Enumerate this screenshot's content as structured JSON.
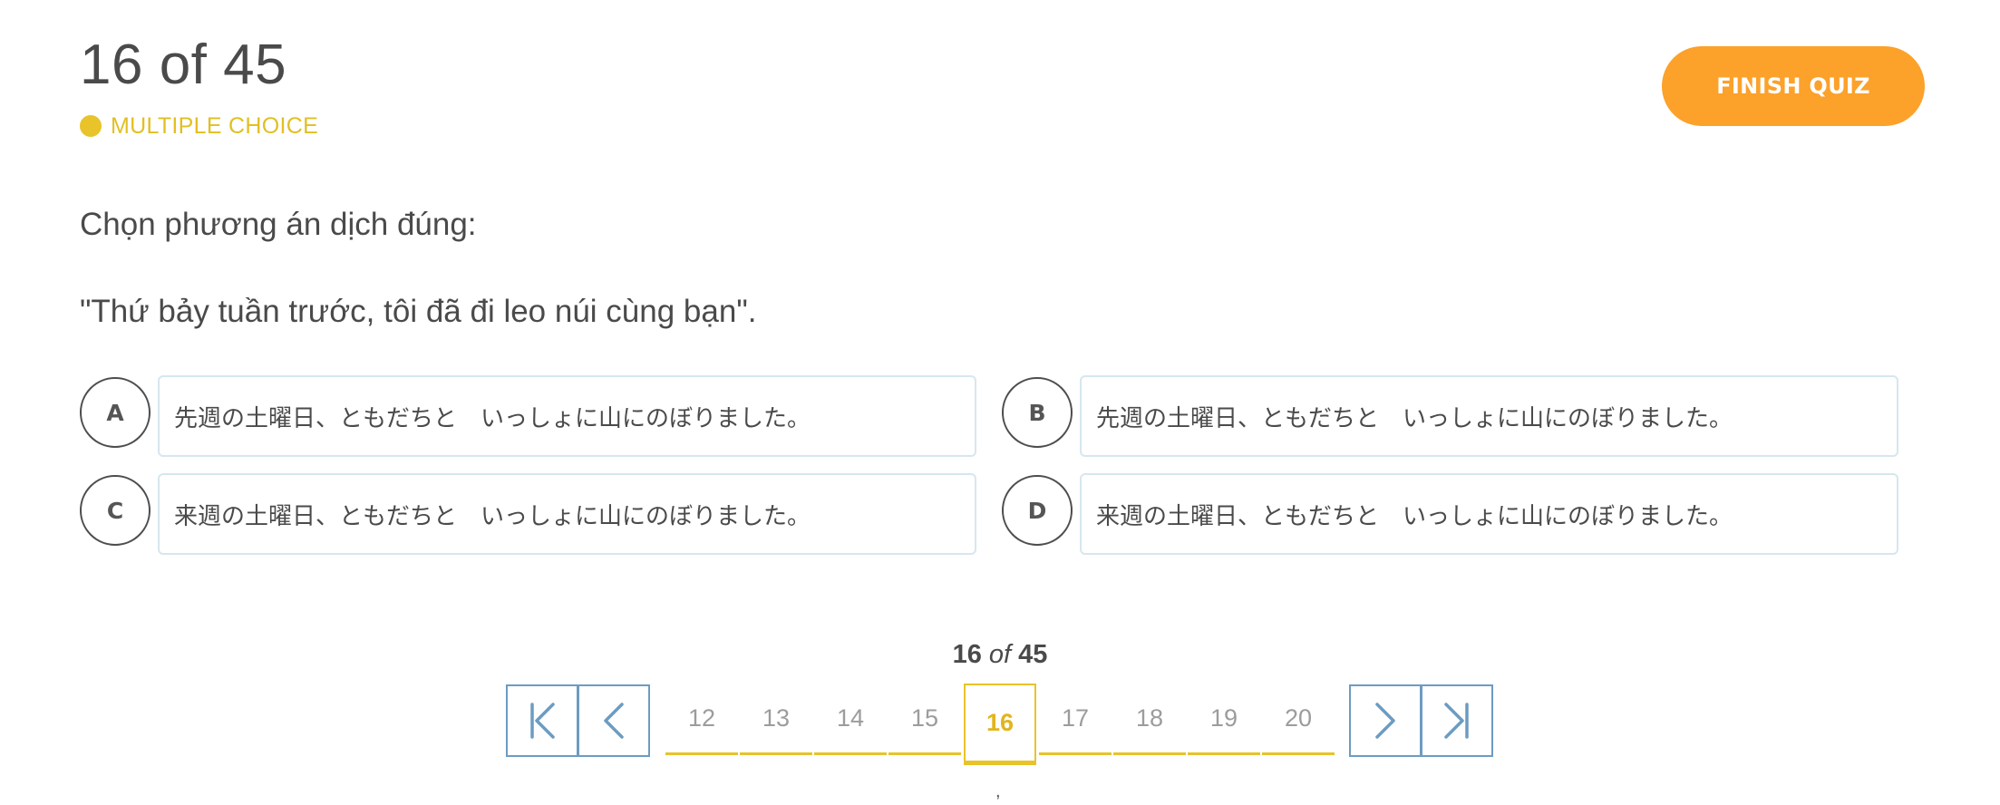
{
  "header": {
    "counter": "16 of 45",
    "question_type": "MULTIPLE CHOICE",
    "finish_label": "FINISH QUIZ"
  },
  "question": {
    "prompt": "Chọn phương án dịch đúng:",
    "sentence": "\"Thứ bảy tuần trước, tôi đã đi leo núi cùng bạn\"."
  },
  "options": [
    {
      "letter": "A",
      "text": "先週の土曜日、ともだちと　いっしょに山にのぼりました。"
    },
    {
      "letter": "B",
      "text": "先週の土曜日、ともだちと　いっしょに山にのぼりました。"
    },
    {
      "letter": "C",
      "text": "来週の土曜日、ともだちと　いっしょに山にのぼりました。"
    },
    {
      "letter": "D",
      "text": "来週の土曜日、ともだちと　いっしょに山にのぼりました。"
    }
  ],
  "pagination": {
    "current": "16",
    "of": "of",
    "total": "45",
    "pages": [
      "12",
      "13",
      "14",
      "15",
      "16",
      "17",
      "18",
      "19",
      "20"
    ],
    "tick": ","
  },
  "icons": {
    "first": "first-page-icon",
    "prev": "chevron-left-icon",
    "next": "chevron-right-icon",
    "last": "last-page-icon"
  },
  "colors": {
    "accent_orange": "#fca12a",
    "accent_yellow": "#e8c32a",
    "nav_blue": "#6c9cc2",
    "option_border": "#d6e7ee"
  }
}
